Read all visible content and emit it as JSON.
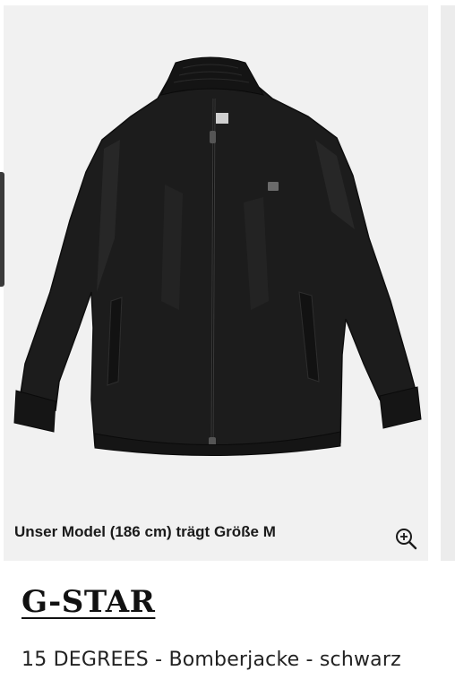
{
  "product_image": {
    "alt_icon": "jacket-image",
    "caption": "Unser Model (186 cm) trägt Größe M",
    "zoom_icon": "zoom-in-icon"
  },
  "product": {
    "brand": "G-STAR",
    "name": "15 DEGREES - Bomberjacke - schwarz"
  },
  "colors": {
    "background": "#ffffff",
    "image_background": "#f1f1f1",
    "jacket": "#1c1c1c",
    "text": "#1a1a1a"
  }
}
